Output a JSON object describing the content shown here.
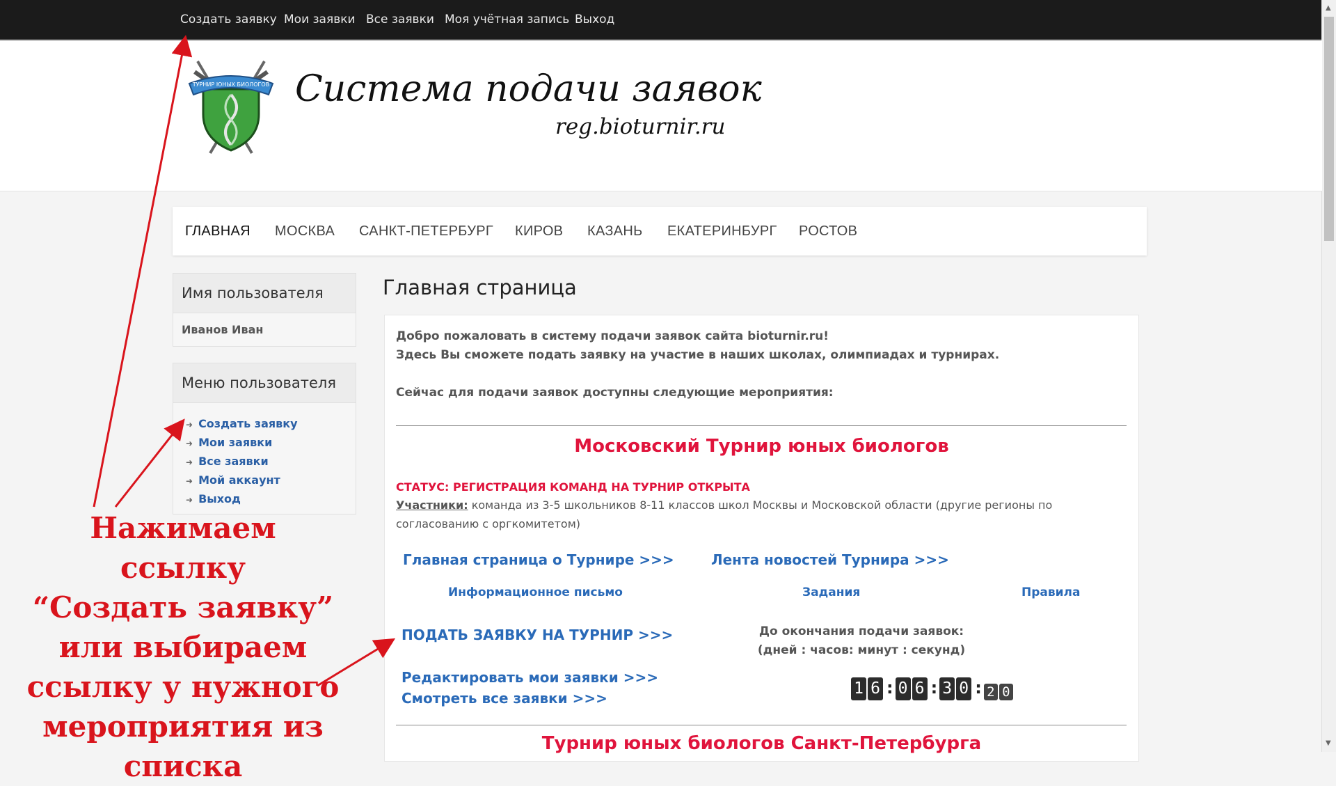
{
  "topnav": [
    "Создать заявку",
    "Мои заявки",
    "Все заявки",
    "Моя учётная запись",
    "Выход"
  ],
  "header": {
    "title": "Система подачи заявок",
    "url": "reg.bioturnir.ru",
    "logo_text": "ТУРНИР ЮНЫХ БИОЛОГОВ"
  },
  "citynav": [
    "ГЛАВНАЯ",
    "МОСКВА",
    "САНКТ-ПЕТЕРБУРГ",
    "КИРОВ",
    "КАЗАНЬ",
    "ЕКАТЕРИНБУРГ",
    "РОСТОВ"
  ],
  "sidebar": {
    "user_heading": "Имя пользователя",
    "user_name": "Иванов Иван",
    "menu_heading": "Меню пользователя",
    "menu": [
      "Создать заявку",
      "Мои заявки",
      "Все заявки",
      "Мой аккаунт",
      "Выход"
    ]
  },
  "main": {
    "page_title": "Главная страница",
    "intro1": "Добро пожаловать в систему подачи заявок сайта bioturnir.ru!",
    "intro2": "Здесь Вы сможете подать заявку на участие в наших школах, олимпиадах и турнирах.",
    "intro3": "Сейчас для подачи заявок доступны следующие мероприятия:",
    "event": {
      "title": "Московский Турнир юных биологов",
      "status": "СТАТУС: РЕГИСТРАЦИЯ КОМАНД НА ТУРНИР ОТКРЫТА",
      "participants_label": "Участники:",
      "participants_text": " команда из 3-5 школьников 8-11 классов школ Москвы и Московской области (другие регионы по согласованию с оргкомитетом)",
      "link_main": "Главная страница о Турнире >>>",
      "link_news": "Лента новостей Турнира >>>",
      "link_letter": "Информационное письмо",
      "link_tasks": "Задания",
      "link_rules": "Правила",
      "link_apply": "ПОДАТЬ ЗАЯВКУ НА ТУРНИР >>>",
      "link_edit": "Редактировать мои заявки >>>",
      "link_view": "Смотреть все заявки >>>",
      "countdown_label1": "До окончания подачи заявок:",
      "countdown_label2": "(дней : часов: минут : секунд)",
      "countdown_days": [
        "1",
        "6"
      ],
      "countdown_hours": [
        "0",
        "6"
      ],
      "countdown_minutes": [
        "3",
        "0"
      ],
      "countdown_seconds": [
        "2",
        "0"
      ]
    },
    "next_event_title": "Турнир юных биологов Санкт-Петербурга"
  },
  "annotation": [
    "Нажимаем ссылку",
    "“Создать заявку”",
    "или выбираем",
    "ссылку у нужного",
    "мероприятия из",
    "списка"
  ],
  "colors": {
    "accent_red": "#e0143c",
    "link_blue": "#2a6ab8",
    "annotation_red": "#d9141c",
    "topbar": "#1b1b1b"
  }
}
